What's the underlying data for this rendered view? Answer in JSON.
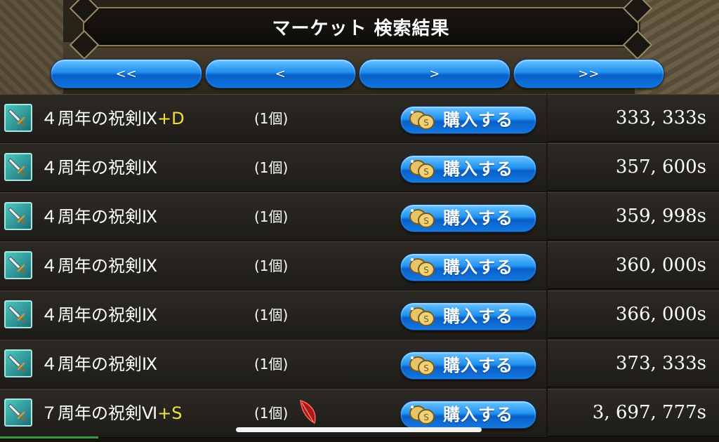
{
  "header": {
    "title": "マーケット 検索結果"
  },
  "pagination": {
    "first_label": "<<",
    "prev_label": "<",
    "next_label": ">",
    "last_label": ">>"
  },
  "listings": [
    {
      "name": "４周年の祝剣Ⅸ",
      "suffix": "+D",
      "quantity": "(1個)",
      "button": "購入する",
      "price": "333, 333s",
      "feather": false
    },
    {
      "name": "４周年の祝剣Ⅸ",
      "suffix": "",
      "quantity": "(1個)",
      "button": "購入する",
      "price": "357, 600s",
      "feather": false
    },
    {
      "name": "４周年の祝剣Ⅸ",
      "suffix": "",
      "quantity": "(1個)",
      "button": "購入する",
      "price": "359, 998s",
      "feather": false
    },
    {
      "name": "４周年の祝剣Ⅸ",
      "suffix": "",
      "quantity": "(1個)",
      "button": "購入する",
      "price": "360, 000s",
      "feather": false
    },
    {
      "name": "４周年の祝剣Ⅸ",
      "suffix": "",
      "quantity": "(1個)",
      "button": "購入する",
      "price": "366, 000s",
      "feather": false
    },
    {
      "name": "４周年の祝剣Ⅸ",
      "suffix": "",
      "quantity": "(1個)",
      "button": "購入する",
      "price": "373, 333s",
      "feather": false
    },
    {
      "name": "７周年の祝剣Ⅵ",
      "suffix": "+S",
      "quantity": "(1個)",
      "button": "購入する",
      "price": "3, 697, 777s",
      "feather": true
    }
  ],
  "colors": {
    "accent_blue": "#1f8ef0",
    "suffix_yellow": "#f3e13a",
    "frame_gold": "#8a7a5a"
  },
  "icons": {
    "item": "sword-icon",
    "coin": "coin-icon",
    "feather": "red-feather-icon"
  }
}
